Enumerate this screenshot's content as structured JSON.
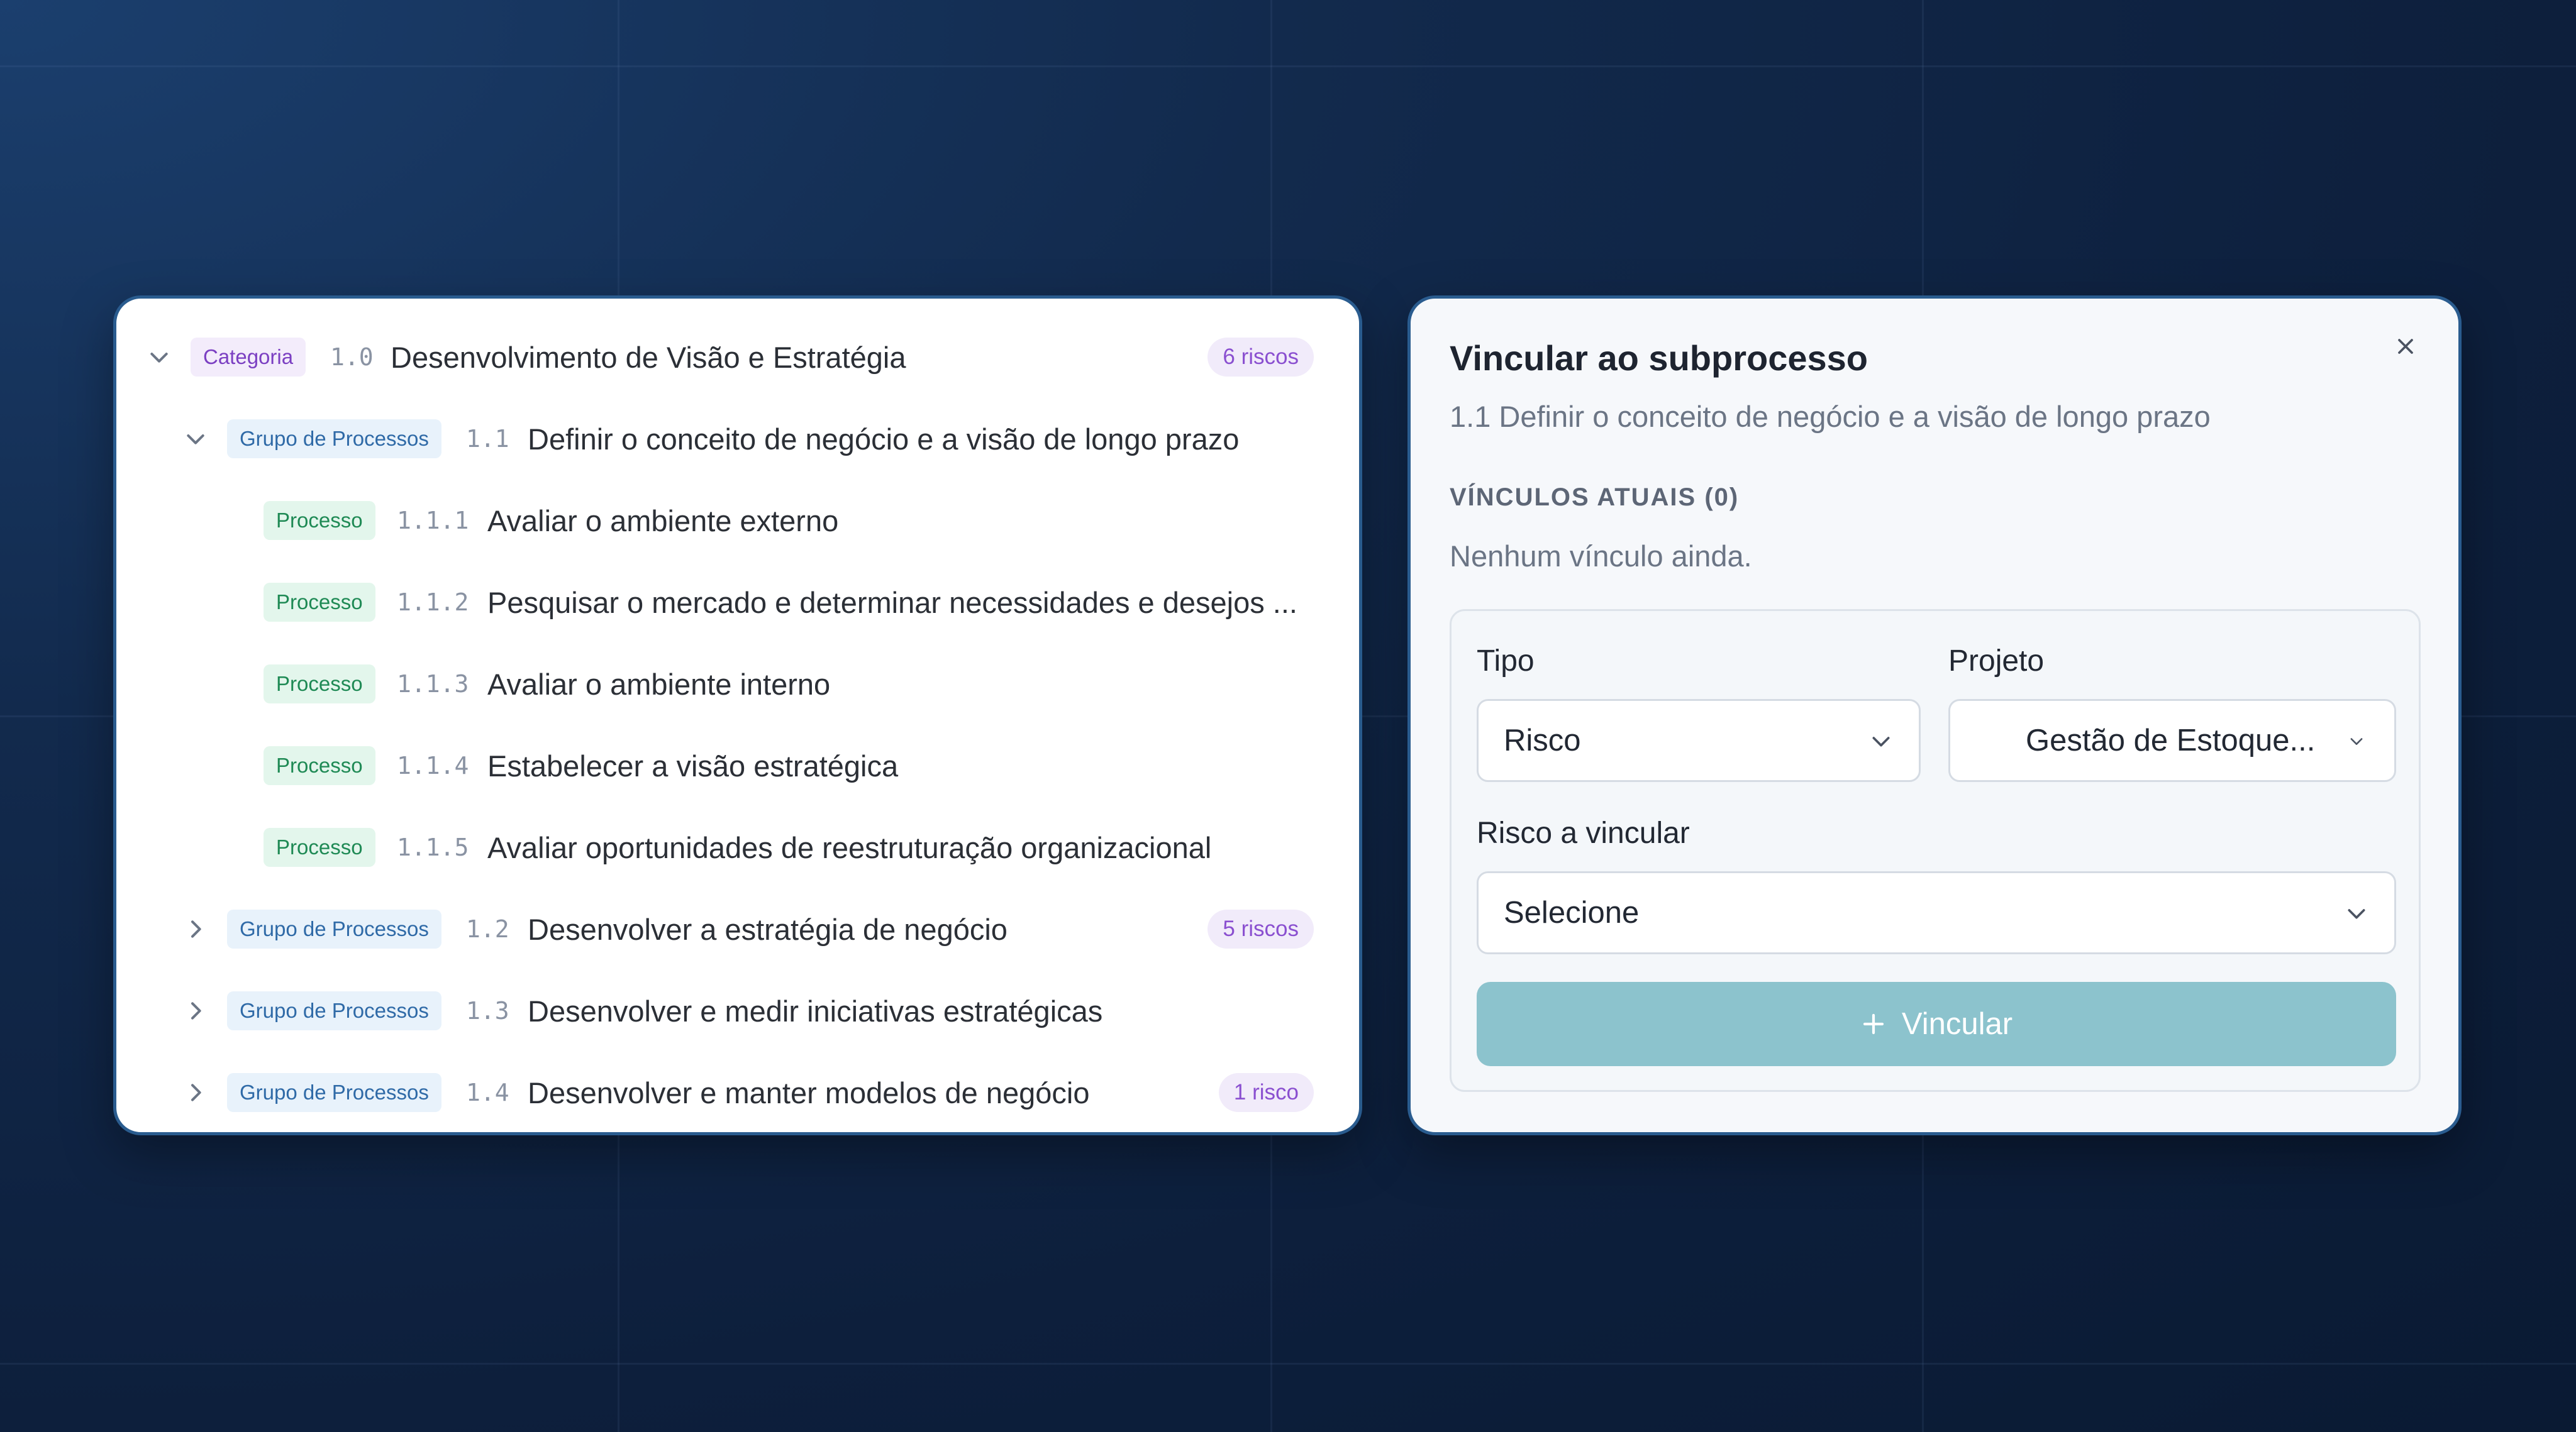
{
  "tree": {
    "rows": [
      {
        "tag": "Categoria",
        "code": "1.0",
        "label": "Desenvolvimento de Visão e Estratégia",
        "badge": "6 riscos"
      },
      {
        "tag": "Grupo de Processos",
        "code": "1.1",
        "label": "Definir o conceito de negócio e a visão de longo prazo"
      },
      {
        "tag": "Processo",
        "code": "1.1.1",
        "label": "Avaliar o ambiente externo"
      },
      {
        "tag": "Processo",
        "code": "1.1.2",
        "label": "Pesquisar o mercado e determinar necessidades e desejos ..."
      },
      {
        "tag": "Processo",
        "code": "1.1.3",
        "label": "Avaliar o ambiente interno"
      },
      {
        "tag": "Processo",
        "code": "1.1.4",
        "label": "Estabelecer a visão estratégica"
      },
      {
        "tag": "Processo",
        "code": "1.1.5",
        "label": "Avaliar oportunidades de reestruturação organizacional"
      },
      {
        "tag": "Grupo de Processos",
        "code": "1.2",
        "label": "Desenvolver a estratégia de negócio",
        "badge": "5 riscos"
      },
      {
        "tag": "Grupo de Processos",
        "code": "1.3",
        "label": "Desenvolver e medir iniciativas estratégicas"
      },
      {
        "tag": "Grupo de Processos",
        "code": "1.4",
        "label": "Desenvolver e manter modelos de negócio",
        "badge": "1 risco"
      }
    ]
  },
  "link_panel": {
    "title": "Vincular ao subprocesso",
    "subtitle": "1.1 Definir o conceito de negócio e a visão de longo prazo",
    "links_heading": "VÍNCULOS ATUAIS (0)",
    "links_empty": "Nenhum vínculo ainda.",
    "form": {
      "tipo_label": "Tipo",
      "tipo_value": "Risco",
      "projeto_label": "Projeto",
      "projeto_value": "Gestão de Estoque...",
      "risco_label": "Risco a vincular",
      "risco_value": "Selecione",
      "submit_label": "Vincular"
    }
  },
  "icons": {
    "expanded": "chevron-down-icon",
    "collapsed": "chevron-right-icon",
    "close": "close-icon",
    "add": "plus-icon"
  },
  "colors": {
    "categoria_tag": "#7b3fc2",
    "grupo_tag": "#2f6aa7",
    "processo_tag": "#1f8a55",
    "badge": "#8a4fd0",
    "submit_button": "#8cc3cd",
    "panel_border": "#2a5c8f"
  }
}
